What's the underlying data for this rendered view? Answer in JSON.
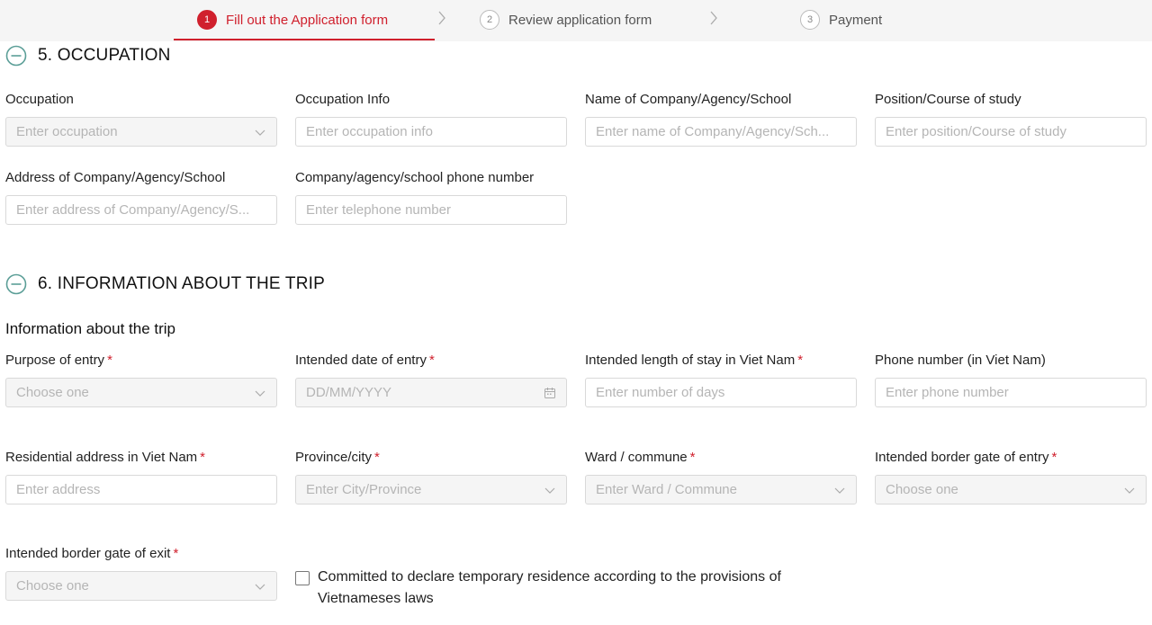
{
  "stepper": {
    "steps": [
      {
        "number": "1",
        "label": "Fill out the Application form",
        "active": true
      },
      {
        "number": "2",
        "label": "Review application form",
        "active": false
      },
      {
        "number": "3",
        "label": "Payment",
        "active": false
      }
    ]
  },
  "colors": {
    "accent": "#d0202d",
    "toggle": "#5b9e97",
    "input_border": "#d9d9d9"
  },
  "occupation": {
    "title": "5. OCCUPATION",
    "fields": {
      "occupation": {
        "label": "Occupation",
        "placeholder": "Enter occupation",
        "icon": "chevron-down-icon"
      },
      "occupation_info": {
        "label": "Occupation Info",
        "placeholder": "Enter occupation info"
      },
      "company_name": {
        "label": "Name of Company/Agency/School",
        "placeholder": "Enter name of Company/Agency/Sch..."
      },
      "position": {
        "label": "Position/Course of study",
        "placeholder": "Enter position/Course of study"
      },
      "company_address": {
        "label": "Address of Company/Agency/School",
        "placeholder": "Enter address of Company/Agency/S..."
      },
      "company_phone": {
        "label": "Company/agency/school phone number",
        "placeholder": "Enter telephone number"
      }
    }
  },
  "trip": {
    "title": "6. INFORMATION ABOUT THE TRIP",
    "subtitle": "Information about the trip",
    "fields": {
      "purpose": {
        "label": "Purpose of entry",
        "required": "*",
        "placeholder": "Choose one",
        "icon": "chevron-down-icon"
      },
      "entry_date": {
        "label": "Intended date of entry",
        "required": "*",
        "placeholder": "DD/MM/YYYY",
        "icon": "calendar-icon"
      },
      "length_of_stay": {
        "label": "Intended length of stay in Viet Nam",
        "required": "*",
        "placeholder": "Enter number of days"
      },
      "phone_vn": {
        "label": "Phone number (in Viet Nam)",
        "placeholder": "Enter phone number"
      },
      "residential_address": {
        "label": "Residential address in Viet Nam",
        "required": "*",
        "placeholder": "Enter address"
      },
      "province": {
        "label": "Province/city",
        "required": "*",
        "placeholder": "Enter City/Province",
        "icon": "chevron-down-icon"
      },
      "ward": {
        "label": "Ward / commune",
        "required": "*",
        "placeholder": "Enter Ward / Commune",
        "icon": "chevron-down-icon"
      },
      "border_entry": {
        "label": "Intended border gate of entry",
        "required": "*",
        "placeholder": "Choose one",
        "icon": "chevron-down-icon"
      },
      "border_exit": {
        "label": "Intended border gate of exit",
        "required": "*",
        "placeholder": "Choose one",
        "icon": "chevron-down-icon"
      }
    },
    "commitment": {
      "label": "Committed to declare temporary residence according to the provisions of Vietnameses laws",
      "checked": false
    }
  }
}
